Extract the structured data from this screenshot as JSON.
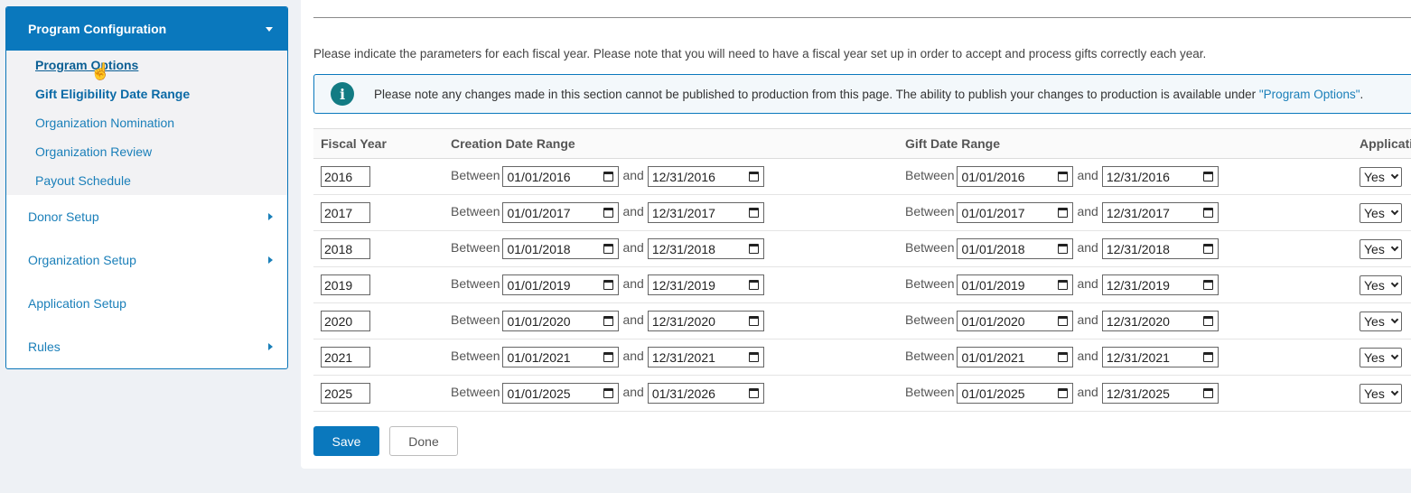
{
  "sidebar": {
    "header": "Program Configuration",
    "sub_items": [
      {
        "label": "Program Options"
      },
      {
        "label": "Gift Eligibility Date Range"
      },
      {
        "label": "Organization Nomination"
      },
      {
        "label": "Organization Review"
      },
      {
        "label": "Payout Schedule"
      }
    ],
    "items": [
      {
        "label": "Donor Setup"
      },
      {
        "label": "Organization Setup"
      },
      {
        "label": "Application Setup"
      },
      {
        "label": "Rules"
      }
    ]
  },
  "main": {
    "intro": "Please indicate the parameters for each fiscal year. Please note that you will need to have a fiscal year set up in order to accept and process gifts correctly each year.",
    "notice_text": "Please note any changes made in this section cannot be published to production from this page. The ability to publish your changes to production is available under",
    "notice_link": "\"Program Options\"",
    "notice_end": ".",
    "columns": [
      "Fiscal Year",
      "Creation Date Range",
      "Gift Date Range",
      "Applicatio"
    ],
    "between_label": "Between",
    "and_label": "and",
    "rows": [
      {
        "year": "2016",
        "c_from": "01/01/2016",
        "c_to": "12/31/2016",
        "g_from": "01/01/2016",
        "g_to": "12/31/2016",
        "app": "Yes"
      },
      {
        "year": "2017",
        "c_from": "01/01/2017",
        "c_to": "12/31/2017",
        "g_from": "01/01/2017",
        "g_to": "12/31/2017",
        "app": "Yes"
      },
      {
        "year": "2018",
        "c_from": "01/01/2018",
        "c_to": "12/31/2018",
        "g_from": "01/01/2018",
        "g_to": "12/31/2018",
        "app": "Yes"
      },
      {
        "year": "2019",
        "c_from": "01/01/2019",
        "c_to": "12/31/2019",
        "g_from": "01/01/2019",
        "g_to": "12/31/2019",
        "app": "Yes"
      },
      {
        "year": "2020",
        "c_from": "01/01/2020",
        "c_to": "12/31/2020",
        "g_from": "01/01/2020",
        "g_to": "12/31/2020",
        "app": "Yes"
      },
      {
        "year": "2021",
        "c_from": "01/01/2021",
        "c_to": "12/31/2021",
        "g_from": "01/01/2021",
        "g_to": "12/31/2021",
        "app": "Yes"
      },
      {
        "year": "2025",
        "c_from": "01/01/2025",
        "c_to": "01/31/2026",
        "g_from": "01/01/2025",
        "g_to": "12/31/2025",
        "app": "Yes"
      }
    ],
    "save_label": "Save",
    "done_label": "Done"
  },
  "colors": {
    "accent": "#0a78bd",
    "info_icon": "#127b83"
  }
}
